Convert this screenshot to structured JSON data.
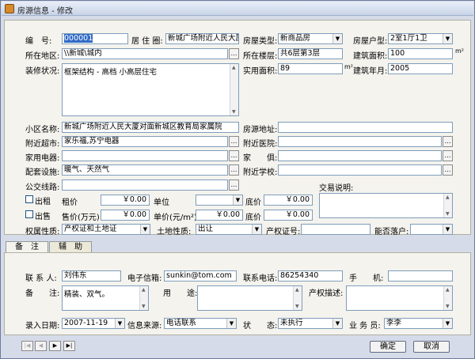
{
  "window": {
    "title": "房源信息 - 修改"
  },
  "icons": {
    "title": "house-icon",
    "ellipsis": "ellipsis-icon",
    "dropdown": "chevron-down-icon"
  },
  "basic": {
    "id_label": "编　号:",
    "id_value": "000001",
    "residence_label": "居 住 圈:",
    "residence_value": "新城广场附近人民大厦",
    "house_type_label": "房屋类型:",
    "house_type_value": "新商品房",
    "house_layout_label": "房屋户型:",
    "house_layout_value": "2室1厅1卫",
    "area_label": "所在地区:",
    "area_value": "\\\\新城\\城内",
    "floor_label": "所在楼层:",
    "floor_value": "共6层第3层",
    "build_area_label": "建筑面积:",
    "build_area_value": "100",
    "build_area_unit": "m²",
    "decor_label": "装修状况:",
    "decor_value": "框架结构 - 高档 小高层住宅",
    "use_area_label": "实用面积:",
    "use_area_value": "89",
    "use_area_unit": "m²",
    "build_year_label": "建筑年月:",
    "build_year_value": "2005",
    "community_label": "小区名称:",
    "community_value": "新城广场附近人民大厦对面新城区教育局家属院",
    "address_label": "房源地址:",
    "address_value": "",
    "market_label": "附近超市:",
    "market_value": "家乐福,苏宁电器",
    "hospital_label": "附近医院:",
    "hospital_value": "",
    "appliance_label": "家用电器:",
    "appliance_value": "",
    "furniture_label": "家　　俱:",
    "furniture_value": "",
    "facility_label": "配套设施:",
    "facility_value": "暖气、天然气",
    "school_label": "附近学校:",
    "school_value": "",
    "bus_label": "公交线路:",
    "bus_value": "",
    "trade_label": "交易说明:",
    "trade_value": ""
  },
  "rent": {
    "checkbox_label": "出租",
    "price_label": "租价",
    "price_value": "￥0.00",
    "unit_label": "单位",
    "unit_value": "",
    "floor_price_label": "底价",
    "floor_price_value": "￥0.00"
  },
  "sale": {
    "checkbox_label": "出售",
    "price_label": "售价(万元)",
    "price_value": "￥0.00",
    "unit_label": "单价(元/m²)",
    "unit_value": "￥0.00",
    "floor_price_label": "底价",
    "floor_price_value": "￥0.00"
  },
  "rights": {
    "property_label": "权属性质:",
    "property_value": "产权证和土地证",
    "land_label": "土地性质:",
    "land_value": "出让",
    "cert_label": "产权证号:",
    "cert_value": "",
    "household_label": "能否落户:",
    "household_value": ""
  },
  "tabs": [
    {
      "label": "备　注"
    },
    {
      "label": "辅　助"
    }
  ],
  "remark": {
    "contact_label": "联 系 人:",
    "contact_value": "刘伟东",
    "email_label": "电子信箱:",
    "email_value": "sunkin@tom.com",
    "phone_label": "联系电话:",
    "phone_value": "86254340",
    "mobile_label": "手　　机:",
    "mobile_value": "",
    "note_label": "备　　注:",
    "note_value": "精装、双气。",
    "usage_label": "用　　途:",
    "usage_value": "",
    "desc_label": "产权描述:",
    "desc_value": "",
    "entry_date_label": "录入日期:",
    "entry_date_value": "2007-11-19",
    "source_label": "信息来源:",
    "source_value": "电话联系",
    "status_label": "状　　态:",
    "status_value": "未执行",
    "agent_label": "业 务 员:",
    "agent_value": "李李"
  },
  "nav": {
    "first": "|◀",
    "prev": "◀",
    "next": "▶",
    "last": "▶|"
  },
  "buttons": {
    "ok": "确定",
    "cancel": "取消"
  }
}
